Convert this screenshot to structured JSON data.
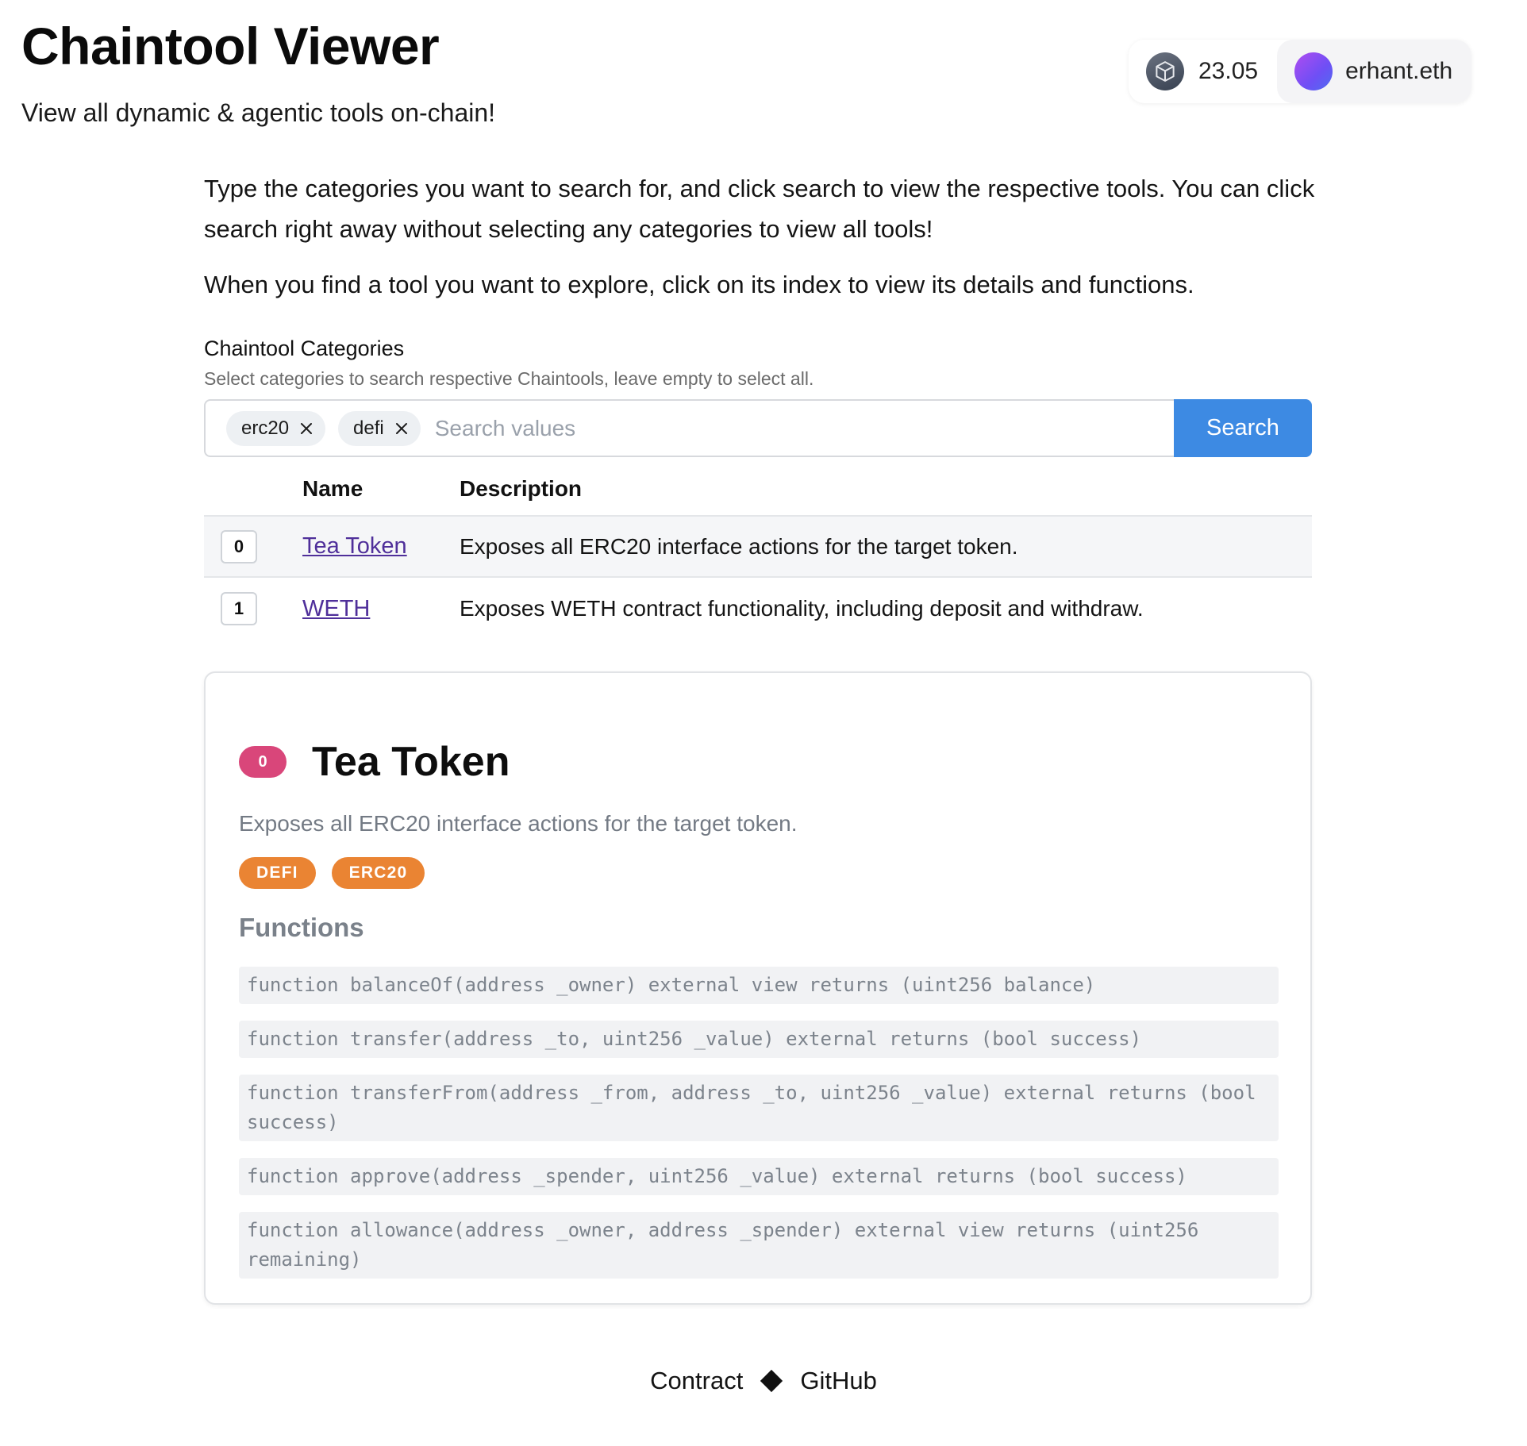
{
  "header": {
    "title": "Chaintool Viewer",
    "subtitle": "View all dynamic & agentic tools on-chain!"
  },
  "wallet": {
    "chain_icon": "cube-icon",
    "balance": "23.05",
    "account": "erhant.eth",
    "avatar_colors": [
      "#b04cf0",
      "#4f6cf0"
    ]
  },
  "intro": {
    "paragraph1": "Type the categories you want to search for, and click search to view the respective tools. You can click search right away without selecting any categories to view all tools!",
    "paragraph2": "When you find a tool you want to explore, click on its index to view its details and functions."
  },
  "categories": {
    "label": "Chaintool Categories",
    "help": "Select categories to search respective Chaintools, leave empty to select all.",
    "selected": [
      "erc20",
      "defi"
    ],
    "placeholder": "Search values",
    "search_label": "Search"
  },
  "table": {
    "headers": {
      "index": "",
      "name": "Name",
      "description": "Description"
    },
    "rows": [
      {
        "index": "0",
        "name": "Tea Token",
        "description": "Exposes all ERC20 interface actions for the target token."
      },
      {
        "index": "1",
        "name": "WETH",
        "description": "Exposes WETH contract functionality, including deposit and withdraw."
      }
    ]
  },
  "detail": {
    "index": "0",
    "title": "Tea Token",
    "description": "Exposes all ERC20 interface actions for the target token.",
    "tags": [
      "DEFI",
      "ERC20"
    ],
    "functions_heading": "Functions",
    "functions": [
      "function balanceOf(address _owner) external view returns (uint256 balance)",
      "function transfer(address _to, uint256 _value) external returns (bool success)",
      "function transferFrom(address _from, address _to, uint256 _value) external returns (bool success)",
      "function approve(address _spender, uint256 _value) external returns (bool success)",
      "function allowance(address _owner, address _spender) external view returns (uint256 remaining)"
    ]
  },
  "footer": {
    "contract": "Contract",
    "github": "GitHub"
  },
  "colors": {
    "accent": "#3d8ae3",
    "index_badge": "#d9467a",
    "category_tag": "#ea8433",
    "link": "#4f2f9a"
  }
}
